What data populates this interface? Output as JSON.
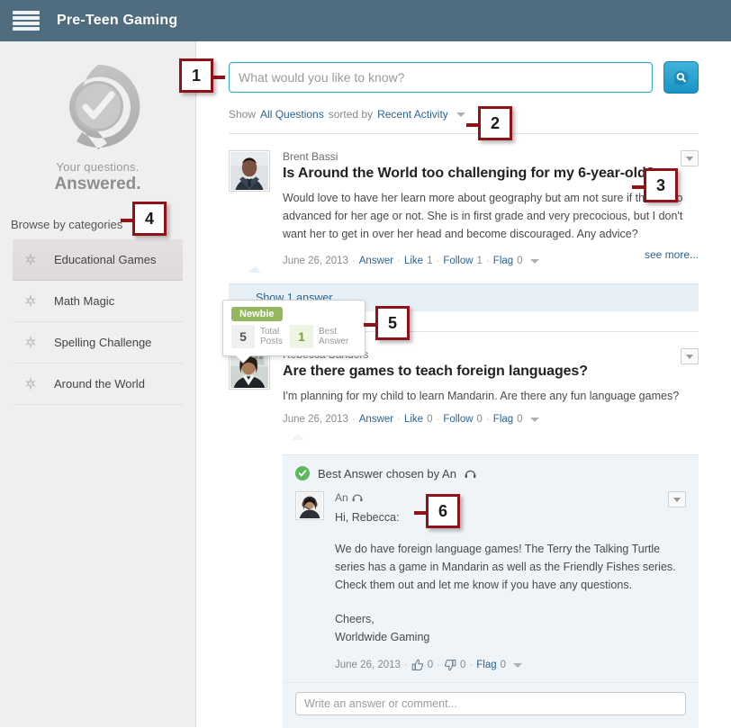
{
  "header": {
    "title": "Pre-Teen Gaming",
    "menu_icon": "hamburger-menu-icon"
  },
  "sidebar": {
    "logo_icon": "q-check-logo",
    "tagline_line1": "Your questions.",
    "tagline_line2": "Answered.",
    "browse_label": "Browse by categories",
    "categories": [
      {
        "label": "Educational Games",
        "icon": "sparkle-icon",
        "active": true
      },
      {
        "label": "Math Magic",
        "icon": "sparkle-icon",
        "active": false
      },
      {
        "label": "Spelling Challenge",
        "icon": "sparkle-icon",
        "active": false
      },
      {
        "label": "Around the World",
        "icon": "sparkle-icon",
        "active": false
      }
    ]
  },
  "search": {
    "placeholder": "What would you like to know?",
    "value": "",
    "button_icon": "search-bubble-icon"
  },
  "filter": {
    "show_label": "Show",
    "show_value": "All Questions",
    "sorted_label": "sorted by",
    "sort_value": "Recent Activity",
    "caret_icon": "chevron-down-icon"
  },
  "questions": [
    {
      "author": "Brent Bassi",
      "avatar": "man-in-suit-avatar",
      "title": "Is Around the World too challenging for my 6-year-old?",
      "body": "Would love to have her learn more about geography but am not sure if this is too advanced for her age or not. She is in first grade and very precocious, but I don't want her to get in over her head and become discouraged. Any advice?",
      "see_more": "see more...",
      "date": "June 26, 2013",
      "answer_label": "Answer",
      "like_label": "Like",
      "like_count": "1",
      "follow_label": "Follow",
      "follow_count": "1",
      "flag_label": "Flag",
      "flag_count": "0",
      "show_answers": "Show 1 answer",
      "toggle_icon": "chevron-down-icon"
    },
    {
      "author": "Rebecca Sanders",
      "avatar": "woman-outdoors-avatar",
      "title": "Are there games to teach foreign languages?",
      "body": "I'm planning for my child to learn Mandarin. Are there any fun language games?",
      "date": "June 26, 2013",
      "answer_label": "Answer",
      "like_label": "Like",
      "like_count": "0",
      "follow_label": "Follow",
      "follow_count": "0",
      "flag_label": "Flag",
      "flag_count": "0",
      "toggle_icon": "chevron-down-icon"
    }
  ],
  "best_answer": {
    "banner_icon": "green-check-icon",
    "banner_text": "Best Answer chosen by An",
    "banner_name_icon": "agent-headset-icon",
    "avatar": "agent-headset-avatar",
    "author": "An",
    "author_icon": "agent-headset-icon",
    "greeting": "Hi, Rebecca:",
    "body": "We do have foreign language games! The Terry the Talking Turtle series has a game in Mandarin as well as the Friendly Fishes series. Check them out and let me know if you have any questions.",
    "signoff_line1": "Cheers,",
    "signoff_line2": "Worldwide Gaming",
    "date": "June 26, 2013",
    "thumbs_up_icon": "thumbs-up-icon",
    "thumbs_up_count": "0",
    "thumbs_down_icon": "thumbs-down-icon",
    "thumbs_down_count": "0",
    "flag_label": "Flag",
    "flag_count": "0",
    "toggle_icon": "chevron-down-icon"
  },
  "comment_box": {
    "placeholder": "Write an answer or comment..."
  },
  "newbie_tooltip": {
    "badge": "Newbie",
    "total_posts_count": "5",
    "total_posts_label_line1": "Total",
    "total_posts_label_line2": "Posts",
    "best_answer_count": "1",
    "best_answer_label_line1": "Best",
    "best_answer_label_line2": "Answer"
  },
  "callouts": [
    {
      "num": "1"
    },
    {
      "num": "2"
    },
    {
      "num": "3"
    },
    {
      "num": "4"
    },
    {
      "num": "5"
    },
    {
      "num": "6"
    }
  ],
  "colors": {
    "header_bg": "#4f6d7e",
    "accent_blue": "#1a93c4",
    "link_blue": "#2a6496",
    "badge_green": "#95b75d",
    "check_green": "#5cb85c",
    "callout_red": "#8e1218",
    "sidebar_bg": "#efefef"
  }
}
